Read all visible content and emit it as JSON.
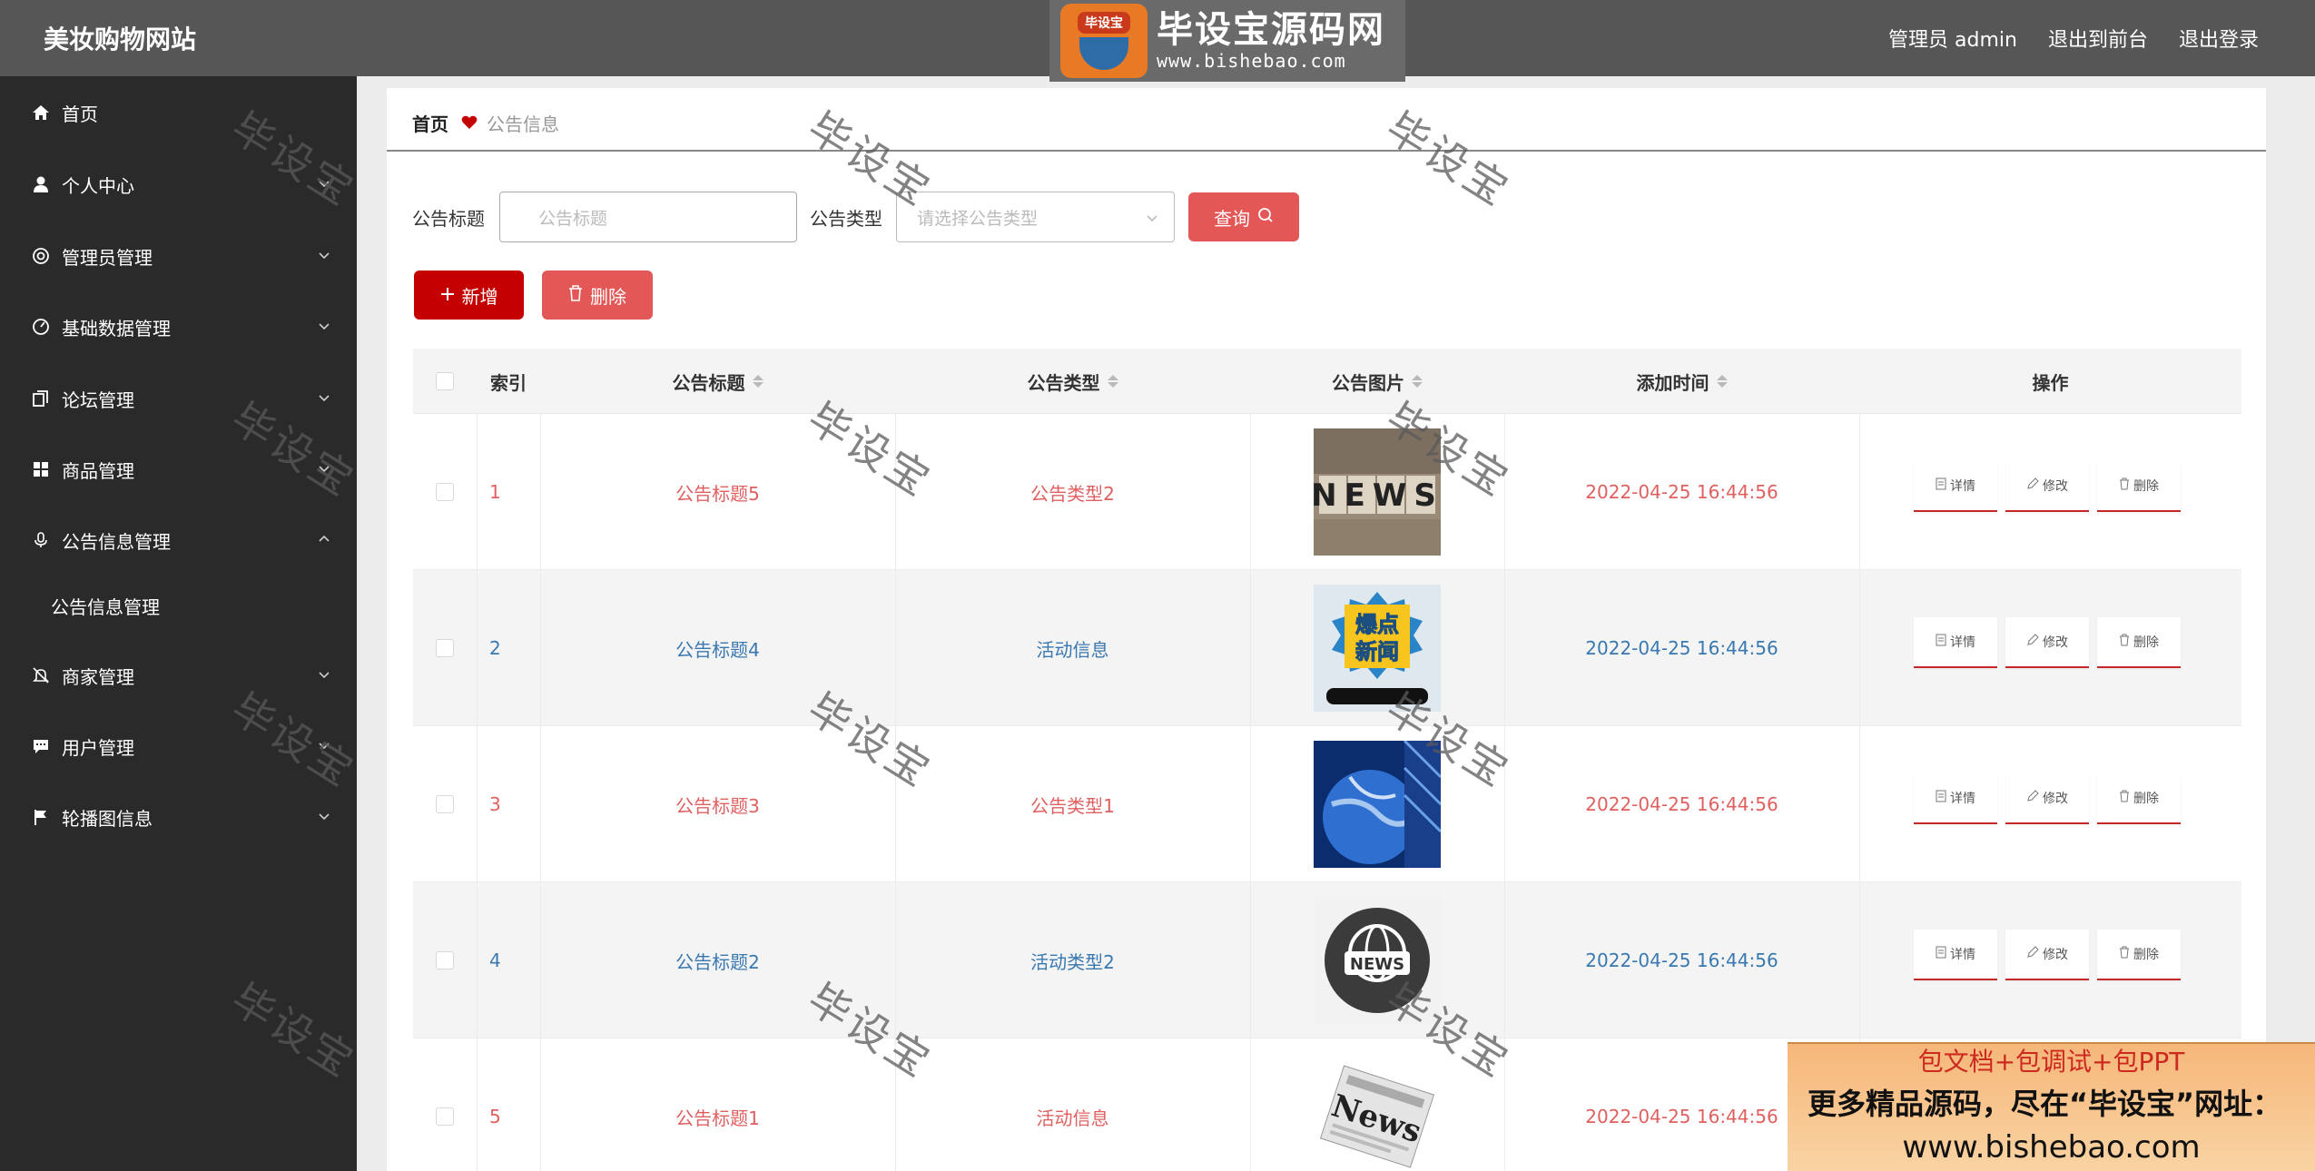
{
  "header": {
    "brand": "美妆购物网站",
    "user_label": "管理员 admin",
    "back_to_front": "退出到前台",
    "logout": "退出登录"
  },
  "logo": {
    "badge_text": "毕设宝",
    "title": "毕设宝源码网",
    "url": "www.bishebao.com"
  },
  "sidebar": {
    "items": [
      {
        "label": "首页",
        "icon": "home-icon"
      },
      {
        "label": "个人中心",
        "icon": "user-icon"
      },
      {
        "label": "管理员管理",
        "icon": "admin-icon"
      },
      {
        "label": "基础数据管理",
        "icon": "dashboard-icon"
      },
      {
        "label": "论坛管理",
        "icon": "copy-icon"
      },
      {
        "label": "商品管理",
        "icon": "grid-icon"
      },
      {
        "label": "公告信息管理",
        "icon": "microphone-icon"
      },
      {
        "label": "商家管理",
        "icon": "bell-off-icon"
      },
      {
        "label": "用户管理",
        "icon": "chat-icon"
      },
      {
        "label": "轮播图信息",
        "icon": "flag-icon"
      }
    ],
    "submenu": {
      "label": "公告信息管理"
    }
  },
  "breadcrumb": {
    "home": "首页",
    "current": "公告信息"
  },
  "search": {
    "title_label": "公告标题",
    "title_placeholder": "公告标题",
    "type_label": "公告类型",
    "type_placeholder": "请选择公告类型",
    "query_button": "查询"
  },
  "actions": {
    "add": "新增",
    "delete": "删除"
  },
  "table": {
    "headers": {
      "index": "索引",
      "title": "公告标题",
      "type": "公告类型",
      "image": "公告图片",
      "time": "添加时间",
      "ops": "操作"
    },
    "op_labels": {
      "detail": "详情",
      "edit": "修改",
      "delete": "删除"
    },
    "rows": [
      {
        "index": "1",
        "title": "公告标题5",
        "type": "公告类型2",
        "time": "2022-04-25 16:44:56",
        "color": "#e06060",
        "image": "news-blocks"
      },
      {
        "index": "2",
        "title": "公告标题4",
        "type": "活动信息",
        "time": "2022-04-25 16:44:56",
        "color": "#3a78b0",
        "image": "breaking-news"
      },
      {
        "index": "3",
        "title": "公告标题3",
        "type": "公告类型1",
        "time": "2022-04-25 16:44:56",
        "color": "#e06060",
        "image": "globe"
      },
      {
        "index": "4",
        "title": "公告标题2",
        "type": "活动类型2",
        "time": "2022-04-25 16:44:56",
        "color": "#3a78b0",
        "image": "news-globe-badge"
      },
      {
        "index": "5",
        "title": "公告标题1",
        "type": "活动信息",
        "time": "2022-04-25 16:44:56",
        "color": "#e06060",
        "image": "newspaper"
      }
    ]
  },
  "watermark": "毕设宝",
  "ad": {
    "line1": "包文档+包调试+包PPT",
    "line2": "更多精品源码，尽在“毕设宝”网址：",
    "line3": "www.bishebao.com"
  },
  "image_text": {
    "news": "NEWS",
    "breaking_line1": "爆点",
    "breaking_line2": "新闻",
    "paper": "News"
  },
  "colors": {
    "accent_red": "#c40000",
    "delete_btn": "#e35757",
    "sidebar_bg": "#2a2a2a",
    "header_bg": "#565656"
  }
}
